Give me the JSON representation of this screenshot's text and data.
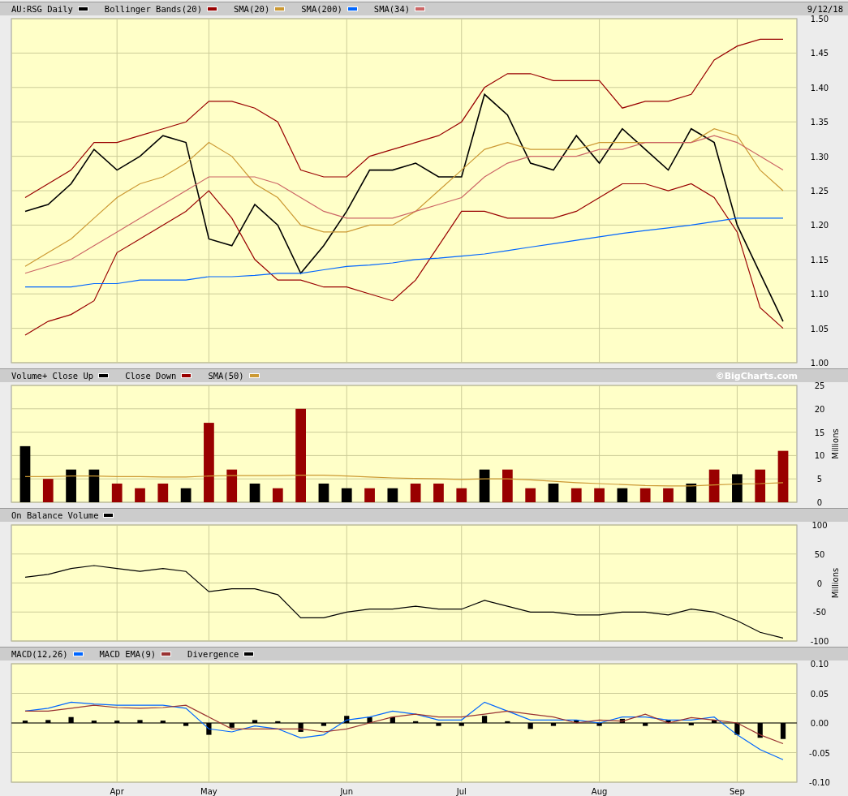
{
  "panels": [
    {
      "date": "9/12/18",
      "chart_data": {
        "type": "line",
        "grid": true,
        "categories": [
          null,
          null,
          null,
          null,
          null,
          null,
          null,
          null,
          null,
          null,
          null,
          null,
          null,
          null,
          null,
          null,
          null,
          null,
          null,
          null,
          null,
          null,
          null,
          null,
          null,
          null,
          null,
          null,
          null,
          null,
          null,
          null,
          null,
          null
        ],
        "ylim": [
          1.0,
          1.5
        ],
        "yticks": [
          {
            "value": 1.0,
            "label": "1.00"
          },
          {
            "value": 1.05,
            "label": "1.05"
          },
          {
            "value": 1.1,
            "label": "1.10"
          },
          {
            "value": 1.15,
            "label": "1.15"
          },
          {
            "value": 1.2,
            "label": "1.20"
          },
          {
            "value": 1.25,
            "label": "1.25"
          },
          {
            "value": 1.3,
            "label": "1.30"
          },
          {
            "value": 1.35,
            "label": "1.35"
          },
          {
            "value": 1.4,
            "label": "1.40"
          },
          {
            "value": 1.45,
            "label": "1.45"
          },
          {
            "value": 1.5,
            "label": "1.50"
          }
        ],
        "series": [
          {
            "name": "AU:RSG Daily",
            "color": "#000000",
            "values": [
              1.22,
              1.23,
              1.26,
              1.31,
              1.28,
              1.3,
              1.33,
              1.32,
              1.18,
              1.17,
              1.23,
              1.2,
              1.13,
              1.17,
              1.22,
              1.28,
              1.28,
              1.29,
              1.27,
              1.27,
              1.39,
              1.36,
              1.29,
              1.28,
              1.33,
              1.29,
              1.34,
              1.31,
              1.28,
              1.34,
              1.32,
              1.2,
              1.13,
              1.06
            ]
          },
          {
            "name": "Bollinger Bands(20)",
            "color": "#990000",
            "values": [
              1.24,
              1.26,
              1.28,
              1.32,
              1.32,
              1.33,
              1.34,
              1.35,
              1.38,
              1.38,
              1.37,
              1.35,
              1.28,
              1.27,
              1.27,
              1.3,
              1.31,
              1.32,
              1.33,
              1.35,
              1.4,
              1.42,
              1.42,
              1.41,
              1.41,
              1.41,
              1.37,
              1.38,
              1.38,
              1.39,
              1.44,
              1.46,
              1.47,
              1.47
            ]
          },
          {
            "color": "#990000",
            "values": [
              1.04,
              1.06,
              1.07,
              1.09,
              1.16,
              1.18,
              1.2,
              1.22,
              1.25,
              1.21,
              1.15,
              1.12,
              1.12,
              1.11,
              1.11,
              1.1,
              1.09,
              1.12,
              1.17,
              1.22,
              1.22,
              1.21,
              1.21,
              1.21,
              1.22,
              1.24,
              1.26,
              1.26,
              1.25,
              1.26,
              1.24,
              1.19,
              1.08,
              1.05
            ]
          },
          {
            "name": "SMA(20)",
            "color": "#cc9933",
            "values": [
              1.14,
              1.16,
              1.18,
              1.21,
              1.24,
              1.26,
              1.27,
              1.29,
              1.32,
              1.3,
              1.26,
              1.24,
              1.2,
              1.19,
              1.19,
              1.2,
              1.2,
              1.22,
              1.25,
              1.28,
              1.31,
              1.32,
              1.31,
              1.31,
              1.31,
              1.32,
              1.32,
              1.32,
              1.32,
              1.32,
              1.34,
              1.33,
              1.28,
              1.25
            ]
          },
          {
            "name": "SMA(200)",
            "color": "#0066ff",
            "values": [
              1.11,
              1.11,
              1.11,
              1.115,
              1.115,
              1.12,
              1.12,
              1.12,
              1.125,
              1.125,
              1.127,
              1.13,
              1.13,
              1.135,
              1.14,
              1.142,
              1.145,
              1.15,
              1.152,
              1.155,
              1.158,
              1.163,
              1.168,
              1.173,
              1.178,
              1.183,
              1.188,
              1.192,
              1.196,
              1.2,
              1.205,
              1.21,
              1.21,
              1.21
            ]
          },
          {
            "name": "SMA(34)",
            "color": "#cc6666",
            "values": [
              1.13,
              1.14,
              1.15,
              1.17,
              1.19,
              1.21,
              1.23,
              1.25,
              1.27,
              1.27,
              1.27,
              1.26,
              1.24,
              1.22,
              1.21,
              1.21,
              1.21,
              1.22,
              1.23,
              1.24,
              1.27,
              1.29,
              1.3,
              1.3,
              1.3,
              1.31,
              1.31,
              1.32,
              1.32,
              1.32,
              1.33,
              1.32,
              1.3,
              1.28
            ]
          }
        ]
      }
    },
    {
      "credit": "©BigCharts.com",
      "chart_data": {
        "type": "bar",
        "grid": true,
        "ylabel": "Millions",
        "categories": [
          null,
          null,
          null,
          null,
          null,
          null,
          null,
          null,
          null,
          null,
          null,
          null,
          null,
          null,
          null,
          null,
          null,
          null,
          null,
          null,
          null,
          null,
          null,
          null,
          null,
          null,
          null,
          null,
          null,
          null,
          null,
          null,
          null,
          null
        ],
        "ylim": [
          0,
          25
        ],
        "yticks": [
          {
            "value": 0,
            "label": "0"
          },
          {
            "value": 5,
            "label": "5"
          },
          {
            "value": 10,
            "label": "10"
          },
          {
            "value": 15,
            "label": "15"
          },
          {
            "value": 20,
            "label": "20"
          },
          {
            "value": 25,
            "label": "25"
          }
        ],
        "series": [
          {
            "name": "Volume+ Close Up",
            "color": "#000000",
            "values": [
              12,
              null,
              7,
              7,
              null,
              null,
              null,
              3,
              null,
              null,
              4,
              null,
              null,
              4,
              3,
              null,
              3,
              null,
              null,
              null,
              7,
              null,
              null,
              4,
              null,
              null,
              3,
              null,
              null,
              4,
              null,
              6,
              null,
              null
            ]
          },
          {
            "name": "Close Down",
            "color": "#990000",
            "values": [
              null,
              5,
              null,
              null,
              4,
              3,
              4,
              null,
              17,
              7,
              null,
              3,
              20,
              null,
              null,
              3,
              null,
              4,
              4,
              3,
              null,
              7,
              3,
              null,
              3,
              3,
              null,
              3,
              3,
              null,
              7,
              null,
              7,
              11
            ]
          },
          {
            "name": "SMA(50)",
            "color": "#cc9933",
            "type": "line",
            "values": [
              5.5,
              5.5,
              5.6,
              5.6,
              5.5,
              5.5,
              5.4,
              5.4,
              5.6,
              5.7,
              5.7,
              5.7,
              5.8,
              5.8,
              5.6,
              5.4,
              5.2,
              5.1,
              5,
              4.9,
              5,
              5,
              4.8,
              4.5,
              4.2,
              4,
              3.8,
              3.6,
              3.5,
              3.5,
              3.7,
              3.9,
              4,
              4.2
            ]
          }
        ]
      }
    },
    {
      "chart_data": {
        "type": "line",
        "grid": true,
        "ylabel": "Millions",
        "categories": [
          null,
          null,
          null,
          null,
          null,
          null,
          null,
          null,
          null,
          null,
          null,
          null,
          null,
          null,
          null,
          null,
          null,
          null,
          null,
          null,
          null,
          null,
          null,
          null,
          null,
          null,
          null,
          null,
          null,
          null,
          null,
          null,
          null,
          null
        ],
        "ylim": [
          -100,
          100
        ],
        "yticks": [
          {
            "value": -100,
            "label": "-100"
          },
          {
            "value": -50,
            "label": "-50"
          },
          {
            "value": 0,
            "label": "0"
          },
          {
            "value": 50,
            "label": "50"
          },
          {
            "value": 100,
            "label": "100"
          }
        ],
        "series": [
          {
            "name": "On Balance Volume",
            "color": "#000000",
            "values": [
              10,
              15,
              25,
              30,
              25,
              20,
              25,
              20,
              -15,
              -10,
              -10,
              -20,
              -60,
              -60,
              -50,
              -45,
              -45,
              -40,
              -45,
              -45,
              -30,
              -40,
              -50,
              -50,
              -55,
              -55,
              -50,
              -50,
              -55,
              -45,
              -50,
              -65,
              -85,
              -95
            ]
          }
        ]
      }
    },
    {
      "chart_data": {
        "type": "line",
        "grid": true,
        "categories": [
          null,
          null,
          null,
          null,
          "Apr",
          null,
          null,
          null,
          "May",
          null,
          null,
          null,
          null,
          null,
          "Jun",
          null,
          null,
          null,
          null,
          "Jul",
          null,
          null,
          null,
          null,
          null,
          "Aug",
          null,
          null,
          null,
          null,
          null,
          "Sep",
          null,
          null
        ],
        "ylim": [
          -0.1,
          0.1
        ],
        "yticks": [
          {
            "value": -0.1,
            "label": "-0.10"
          },
          {
            "value": -0.05,
            "label": "-0.05"
          },
          {
            "value": 0,
            "label": "0.00"
          },
          {
            "value": 0.05,
            "label": "0.05"
          },
          {
            "value": 0.1,
            "label": "0.10"
          }
        ],
        "series": [
          {
            "name": "MACD(12,26)",
            "color": "#0066ff",
            "values": [
              0.02,
              0.025,
              0.035,
              0.032,
              0.03,
              0.03,
              0.03,
              0.025,
              -0.01,
              -0.015,
              -0.005,
              -0.01,
              -0.025,
              -0.02,
              0.005,
              0.01,
              0.02,
              0.015,
              0.005,
              0.005,
              0.035,
              0.02,
              0.005,
              0.005,
              0.005,
              0.0,
              0.01,
              0.01,
              0.005,
              0.005,
              0.01,
              -0.02,
              -0.045,
              -0.062
            ]
          },
          {
            "name": "MACD EMA(9)",
            "color": "#993333",
            "values": [
              0.02,
              0.02,
              0.025,
              0.03,
              0.026,
              0.025,
              0.026,
              0.03,
              0.01,
              -0.01,
              -0.01,
              -0.01,
              -0.01,
              -0.015,
              -0.01,
              0.0,
              0.01,
              0.015,
              0.01,
              0.01,
              0.015,
              0.02,
              0.015,
              0.01,
              0.0,
              0.005,
              0.003,
              0.015,
              0.0,
              0.009,
              0.005,
              0.0,
              -0.02,
              -0.035
            ]
          },
          {
            "name": "Divergence",
            "color": "#000000",
            "type": "bar",
            "values": [
              0.004,
              0.005,
              0.01,
              0.004,
              0.004,
              0.005,
              0.004,
              -0.005,
              -0.02,
              -0.008,
              0.005,
              0.003,
              -0.015,
              -0.005,
              0.012,
              0.01,
              0.01,
              0.003,
              -0.005,
              -0.005,
              0.012,
              0.003,
              -0.01,
              -0.005,
              0.005,
              -0.005,
              0.007,
              -0.005,
              0.005,
              -0.004,
              0.005,
              -0.02,
              -0.025,
              -0.027
            ]
          }
        ]
      }
    }
  ]
}
